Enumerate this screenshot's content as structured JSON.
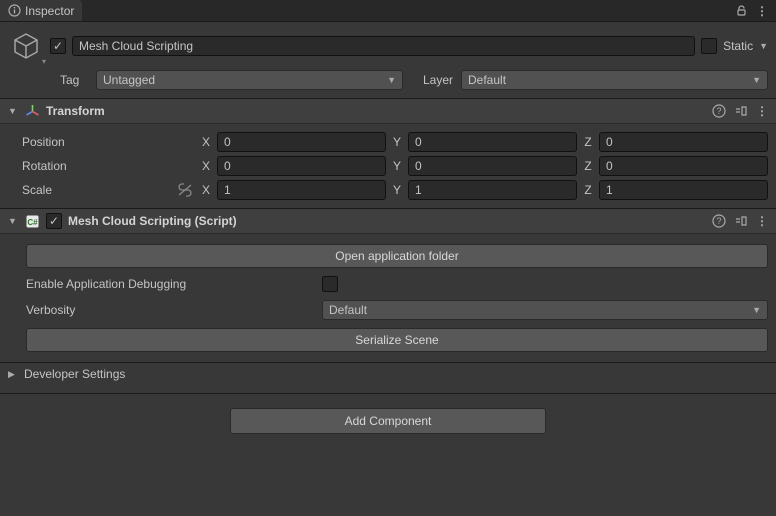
{
  "tab": {
    "title": "Inspector"
  },
  "gameObject": {
    "enabled": true,
    "name": "Mesh Cloud Scripting",
    "staticLabel": "Static",
    "tagLabel": "Tag",
    "tagValue": "Untagged",
    "layerLabel": "Layer",
    "layerValue": "Default"
  },
  "transform": {
    "title": "Transform",
    "positionLabel": "Position",
    "rotationLabel": "Rotation",
    "scaleLabel": "Scale",
    "axes": {
      "x": "X",
      "y": "Y",
      "z": "Z"
    },
    "position": {
      "x": "0",
      "y": "0",
      "z": "0"
    },
    "rotation": {
      "x": "0",
      "y": "0",
      "z": "0"
    },
    "scale": {
      "x": "1",
      "y": "1",
      "z": "1"
    }
  },
  "script": {
    "title": "Mesh Cloud Scripting (Script)",
    "openFolder": "Open application folder",
    "enableDebugLabel": "Enable Application Debugging",
    "verbosityLabel": "Verbosity",
    "verbosityValue": "Default",
    "serialize": "Serialize Scene",
    "devSettings": "Developer Settings"
  },
  "footer": {
    "addComponent": "Add Component"
  }
}
